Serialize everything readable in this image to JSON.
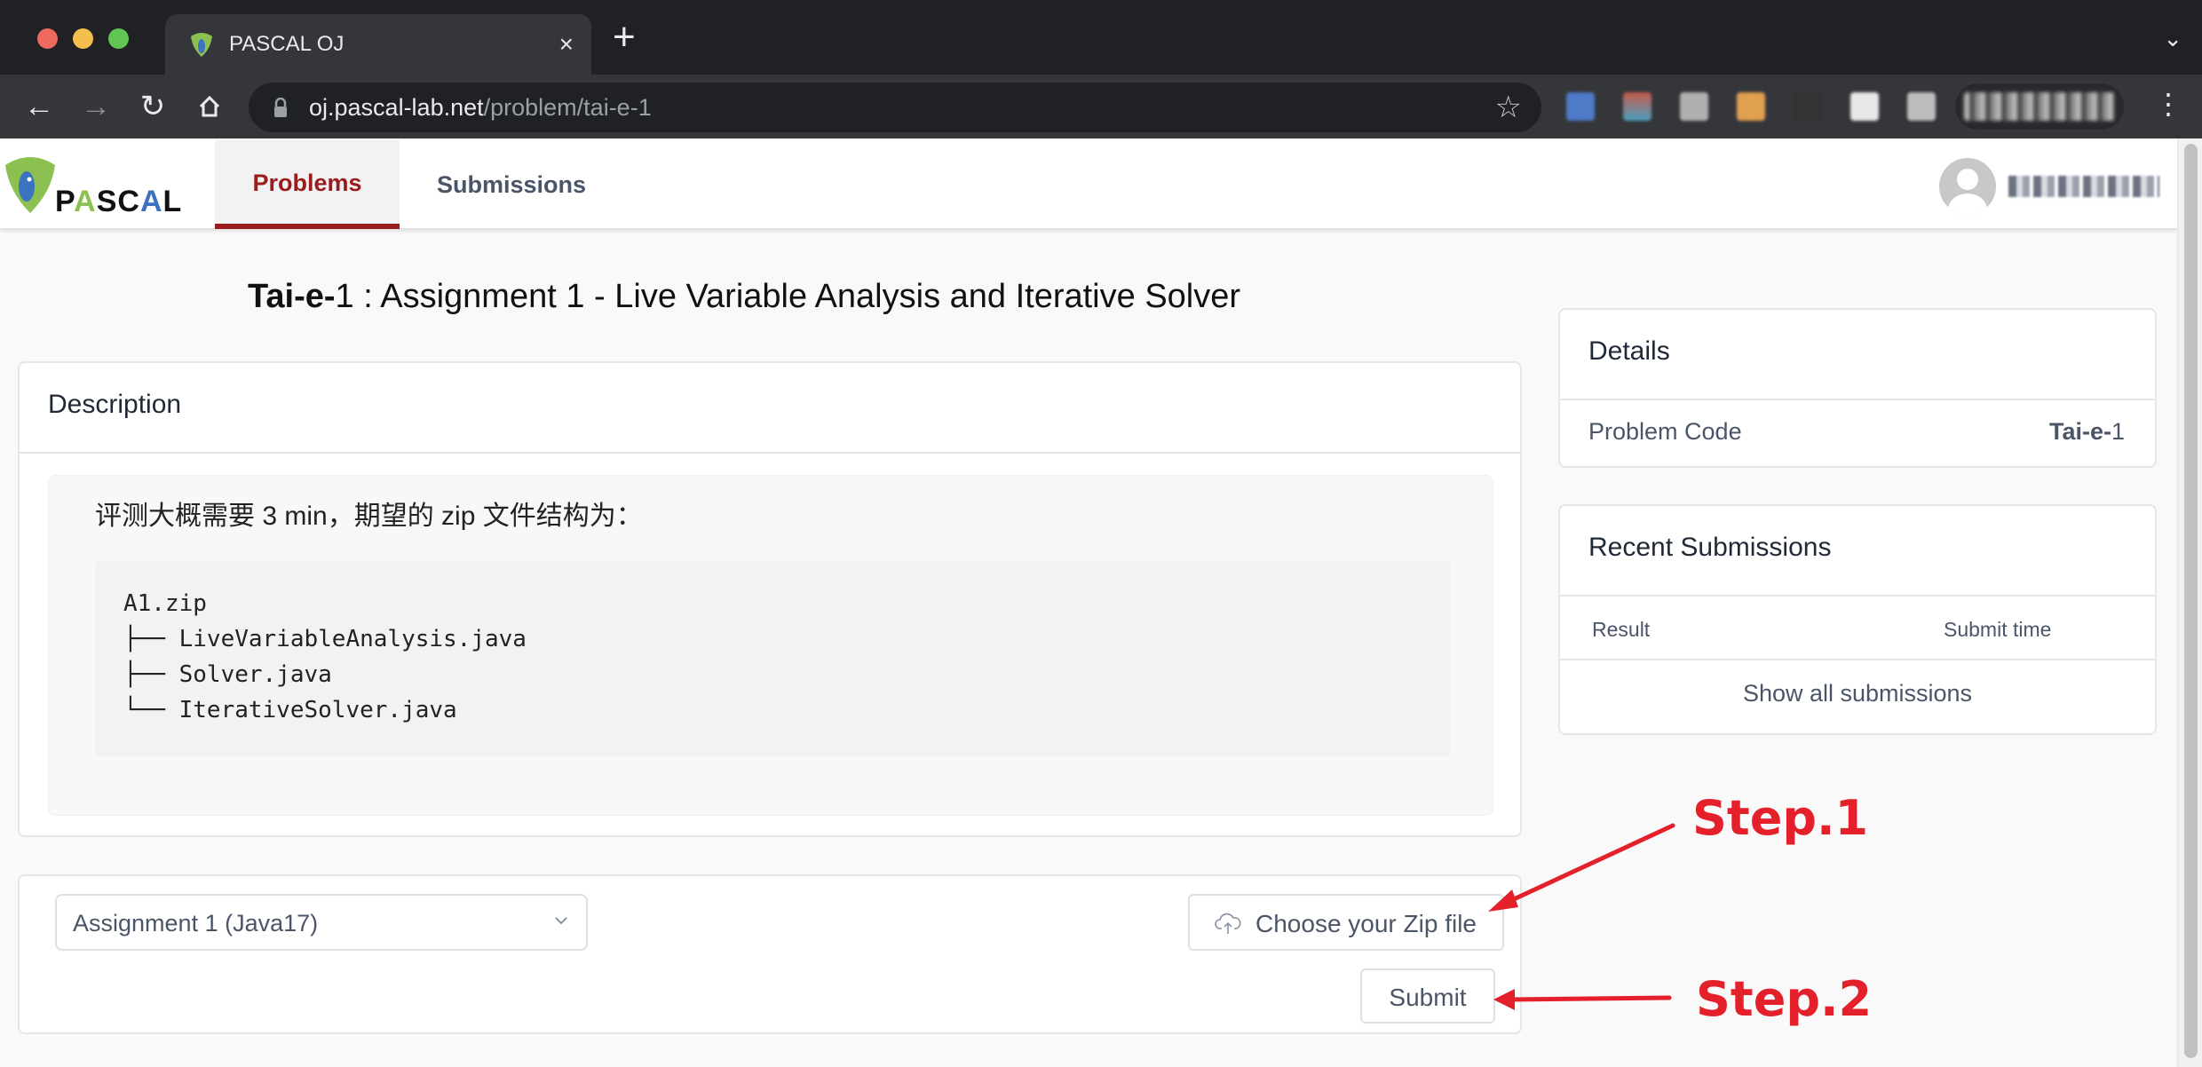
{
  "browser": {
    "tab_title": "PASCAL OJ",
    "tab_close": "×",
    "new_tab": "+",
    "url_host": "oj.pascal-lab.net",
    "url_path": "/problem/tai-e-1"
  },
  "nav": {
    "logo_text": [
      "P",
      "A",
      "SC",
      "A",
      "L"
    ],
    "tabs": [
      {
        "label": "Problems",
        "active": true
      },
      {
        "label": "Submissions",
        "active": false
      }
    ],
    "user_name": "(obscured)"
  },
  "problem": {
    "title_code_bold": "Tai-e-",
    "title_code_num": "1",
    "title_rest": " : Assignment 1 - Live Variable Analysis and Iterative Solver"
  },
  "description": {
    "header": "Description",
    "text": "评测大概需要 3 min，期望的 zip 文件结构为：",
    "code_lines": [
      "A1.zip",
      "├── LiveVariableAnalysis.java",
      "├── Solver.java",
      "└── IterativeSolver.java"
    ]
  },
  "form": {
    "language_select": "Assignment 1 (Java17)",
    "upload_label": "Choose your Zip file",
    "submit_label": "Submit"
  },
  "details": {
    "header": "Details",
    "label": "Problem Code",
    "value_bold": "Tai-e-",
    "value_num": "1"
  },
  "recent": {
    "header": "Recent Submissions",
    "columns": [
      "Result",
      "Submit time"
    ],
    "rows": [],
    "show_all": "Show all submissions"
  },
  "annotations": {
    "step1": "Step.1",
    "step2": "Step.2",
    "color": "#e4202b"
  },
  "colors": {
    "accent": "#9b1c1c",
    "logo_green": "#8cc152",
    "logo_blue": "#3c73c0"
  }
}
